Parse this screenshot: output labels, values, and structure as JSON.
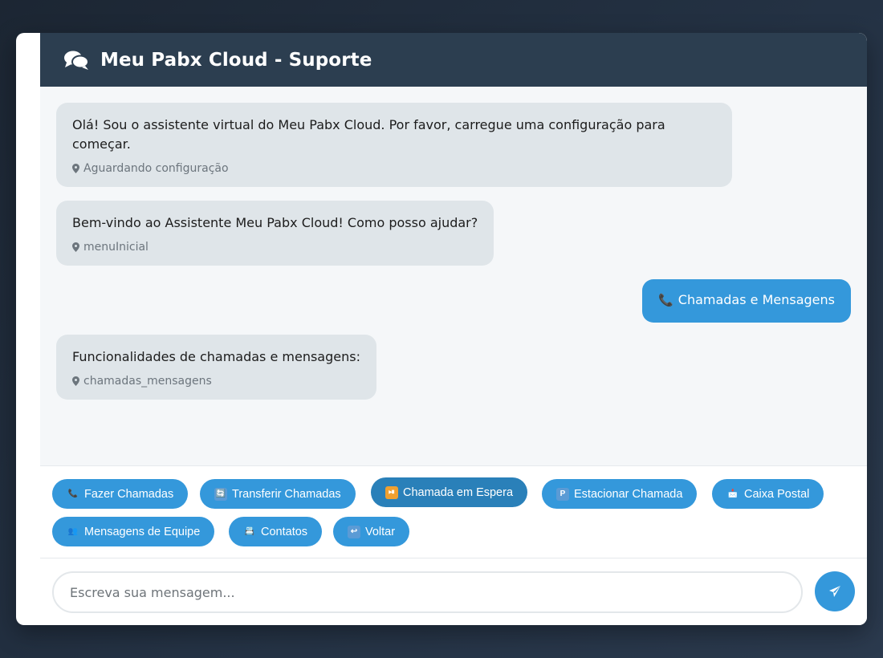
{
  "header": {
    "title": "Meu Pabx Cloud - Suporte",
    "icon": "comments-icon"
  },
  "messages": [
    {
      "sender": "bot",
      "text": "Olá! Sou o assistente virtual do Meu Pabx Cloud. Por favor, carregue uma configuração para começar.",
      "meta": "Aguardando configuração"
    },
    {
      "sender": "bot",
      "text": "Bem-vindo ao Assistente Meu Pabx Cloud! Como posso ajudar?",
      "meta": "menuInicial"
    },
    {
      "sender": "user",
      "icon": "📞",
      "text": "Chamadas e Mensagens"
    },
    {
      "sender": "bot",
      "text": "Funcionalidades de chamadas e mensagens:",
      "meta": "chamadas_mensagens"
    }
  ],
  "quick_replies": [
    {
      "icon": "📞",
      "label": "Fazer Chamadas"
    },
    {
      "icon": "🔄",
      "label": "Transferir Chamadas"
    },
    {
      "icon": "⏯",
      "label": "Chamada em Espera",
      "active": true
    },
    {
      "icon": "P",
      "label": "Estacionar Chamada"
    },
    {
      "icon": "📩",
      "label": "Caixa Postal"
    },
    {
      "icon": "👥",
      "label": "Mensagens de Equipe"
    },
    {
      "icon": "📇",
      "label": "Contatos"
    },
    {
      "icon": "↩",
      "label": "Voltar"
    }
  ],
  "input": {
    "placeholder": "Escreva sua mensagem..."
  },
  "colors": {
    "header": "#2c3e50",
    "accent": "#3498db",
    "bot_bubble": "#dfe5e9",
    "active_button": "#2a80b9"
  }
}
